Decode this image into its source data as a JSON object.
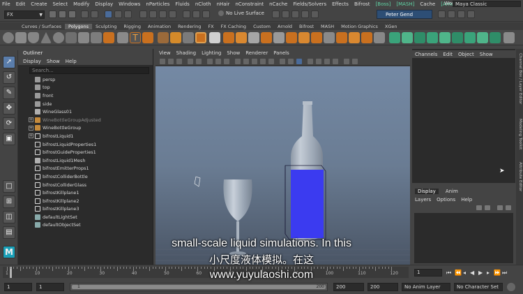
{
  "menubar": {
    "items": [
      "File",
      "Edit",
      "Create",
      "Select",
      "Modify",
      "Display",
      "Windows",
      "nParticles",
      "Fluids",
      "nCloth",
      "nHair",
      "nConstraint",
      "nCache",
      "Fields/Solvers",
      "Effects",
      "Bifrost",
      "[Boss]",
      "[MASH]",
      "Cache",
      "[Arnold]"
    ],
    "highlighted": [
      "[Boss]",
      "[MASH]",
      "[Arnold]"
    ],
    "workspace_label": "Workspace :",
    "workspace_value": "Maya Classic"
  },
  "statusline": {
    "mode": "FX",
    "live_surface": "No Live Surface",
    "user": "Peter Gend"
  },
  "shelf": {
    "tabs": [
      "Curves / Surfaces",
      "Polygons",
      "Sculpting",
      "Rigging",
      "Animation",
      "Rendering",
      "FX",
      "FX Caching",
      "Custom",
      "Arnold",
      "Bifrost",
      "MASH",
      "Motion Graphics",
      "XGen"
    ],
    "active_tab": "Polygons",
    "text_icon_glyph": "T"
  },
  "toolbox": {
    "tools": [
      "select-tool",
      "lasso-tool",
      "paint-select-tool",
      "move-tool",
      "rotate-tool",
      "scale-tool"
    ]
  },
  "outliner": {
    "title": "Outliner",
    "menu": [
      "Display",
      "Show",
      "Help"
    ],
    "search_placeholder": "Search...",
    "items": [
      {
        "label": "persp",
        "icon": "camera",
        "expand": false,
        "dim": false
      },
      {
        "label": "top",
        "icon": "camera",
        "expand": false,
        "dim": false
      },
      {
        "label": "front",
        "icon": "camera",
        "expand": false,
        "dim": false
      },
      {
        "label": "side",
        "icon": "camera",
        "expand": false,
        "dim": false
      },
      {
        "label": "WineGlass01",
        "icon": "mesh",
        "expand": false,
        "dim": false
      },
      {
        "label": "WineBottleGroupAdjusted",
        "icon": "group",
        "expand": true,
        "dim": true
      },
      {
        "label": "WineBottleGroup",
        "icon": "group",
        "expand": true,
        "dim": false
      },
      {
        "label": "bifrostLiquid1",
        "icon": "bifrost",
        "expand": true,
        "dim": false
      },
      {
        "label": "bifrostLiquidProperties1",
        "icon": "bifrost",
        "expand": false,
        "dim": false
      },
      {
        "label": "bifrostGuideProperties1",
        "icon": "bifrost",
        "expand": false,
        "dim": false
      },
      {
        "label": "bifrostLiquid1Mesh",
        "icon": "mesh",
        "expand": false,
        "dim": false
      },
      {
        "label": "bifrostEmitterProps1",
        "icon": "bifrost",
        "expand": false,
        "dim": false
      },
      {
        "label": "bifrostColliderBottle",
        "icon": "bifrost",
        "expand": false,
        "dim": false
      },
      {
        "label": "bifrostColliderGlass",
        "icon": "bifrost",
        "expand": false,
        "dim": false
      },
      {
        "label": "bifrostKillplane1",
        "icon": "bifrost",
        "expand": false,
        "dim": false
      },
      {
        "label": "bifrostKillplane2",
        "icon": "bifrost",
        "expand": false,
        "dim": false
      },
      {
        "label": "bifrostKillplane3",
        "icon": "bifrost",
        "expand": false,
        "dim": false
      },
      {
        "label": "defaultLightSet",
        "icon": "set",
        "expand": false,
        "dim": false
      },
      {
        "label": "defaultObjectSet",
        "icon": "set",
        "expand": false,
        "dim": false
      }
    ]
  },
  "viewport": {
    "menu": [
      "View",
      "Shading",
      "Lighting",
      "Show",
      "Renderer",
      "Panels"
    ],
    "liquid_color": "#3b3bf0"
  },
  "channel_box": {
    "menu": [
      "Channels",
      "Edit",
      "Object",
      "Show"
    ],
    "side_tabs": [
      "Channel Box / Layer Editor",
      "Modeling Toolkit",
      "Attribute Editor"
    ]
  },
  "layer_editor": {
    "tabs": [
      "Display",
      "Anim"
    ],
    "active_tab": "Display",
    "menu": [
      "Layers",
      "Options",
      "Help"
    ]
  },
  "timeslider": {
    "ticks": [
      1,
      10,
      20,
      30,
      40,
      50,
      60,
      70,
      80,
      90,
      100,
      110,
      120
    ],
    "current_frame": "1"
  },
  "range": {
    "start": "1",
    "anim_start": "1",
    "slider_start": "1",
    "slider_end": "200",
    "anim_end": "200",
    "end": "200",
    "anim_layer": "No Anim Layer",
    "character_set": "No Character Set"
  },
  "subtitles": {
    "english": "small-scale liquid simulations. In this",
    "chinese": "小尺度液体模拟。在这",
    "watermark": "www.yuyulaoshi.com"
  }
}
